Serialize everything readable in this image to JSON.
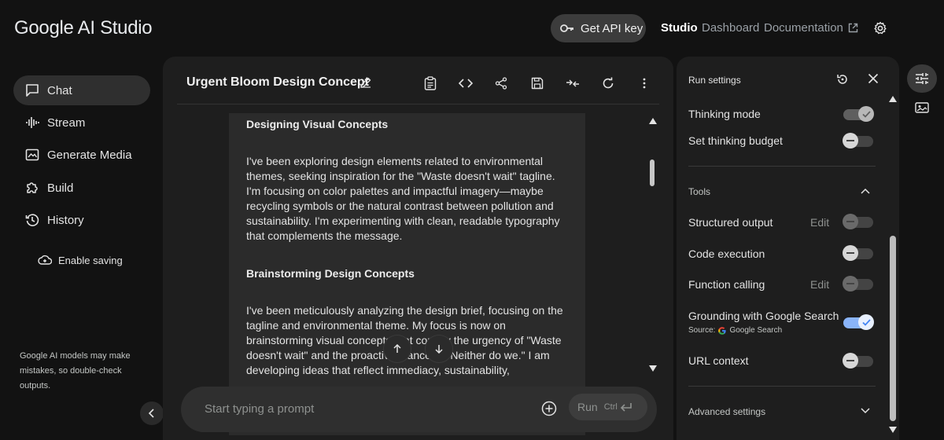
{
  "header": {
    "logo": "Google AI Studio",
    "api_key_button": "Get API key",
    "nav": {
      "studio": "Studio",
      "dashboard": "Dashboard",
      "documentation": "Documentation"
    }
  },
  "sidebar": {
    "items": [
      {
        "label": "Chat",
        "icon": "chat-icon",
        "active": true
      },
      {
        "label": "Stream",
        "icon": "waveform-icon"
      },
      {
        "label": "Generate Media",
        "icon": "media-icon"
      },
      {
        "label": "Build",
        "icon": "puzzle-icon"
      },
      {
        "label": "History",
        "icon": "history-icon"
      }
    ],
    "enable_saving": "Enable saving",
    "disclaimer": "Google AI models may make mistakes, so double-check outputs."
  },
  "chat": {
    "title": "Urgent Bloom Design Concept",
    "thoughts": [
      {
        "heading": "Designing Visual Concepts",
        "body": "I've been exploring design elements related to environmental themes, seeking inspiration for the \"Waste doesn't wait\" tagline. I'm focusing on color palettes and impactful imagery—maybe recycling symbols or the natural contrast between pollution and sustainability. I'm experimenting with clean, readable typography that complements the message."
      },
      {
        "heading": "Brainstorming Design Concepts",
        "body": "I've been meticulously analyzing the design brief, focusing on the tagline and environmental theme. My focus is now on brainstorming visual concepts that convey the urgency of \"Waste doesn't wait\" and the proactive stance of \"Neither do we.\" I am developing ideas that reflect immediacy, sustainability,"
      }
    ],
    "prompt_placeholder": "Start typing a prompt",
    "run_label": "Run",
    "run_shortcut": "Ctrl"
  },
  "run_settings": {
    "title": "Run settings",
    "thinking_mode": {
      "label": "Thinking mode",
      "on": true
    },
    "thinking_budget": {
      "label": "Set thinking budget",
      "on": false
    },
    "tools_label": "Tools",
    "tools": [
      {
        "label": "Structured output",
        "edit": "Edit",
        "on": false
      },
      {
        "label": "Code execution",
        "on": false
      },
      {
        "label": "Function calling",
        "edit": "Edit",
        "on": false
      },
      {
        "label": "Grounding with Google Search",
        "on": true,
        "source_prefix": "Source:",
        "source_name": "Google Search"
      },
      {
        "label": "URL context",
        "on": false
      }
    ],
    "advanced": "Advanced settings"
  },
  "colors": {
    "accent": "#8ab4f8",
    "background": "#121212",
    "panel": "#1e1e1e"
  }
}
